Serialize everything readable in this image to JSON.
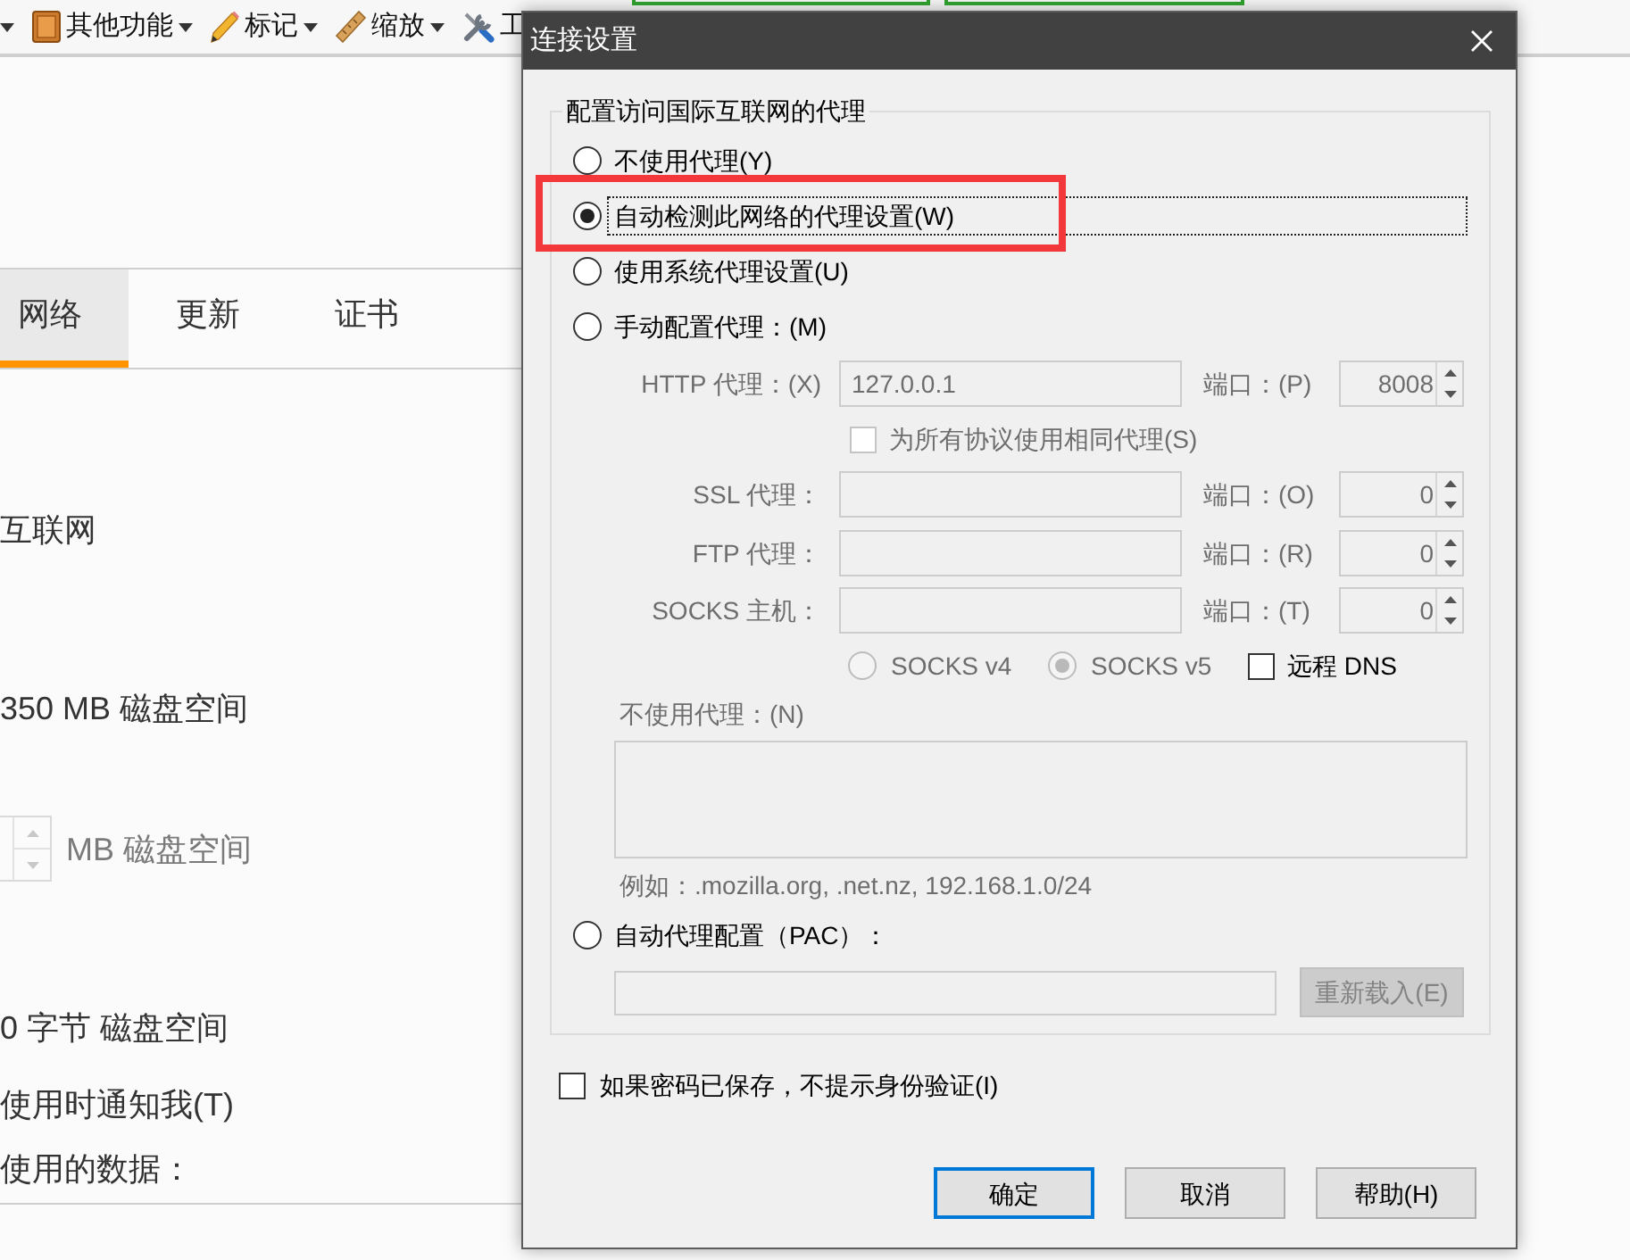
{
  "toolbar": {
    "items": [
      {
        "label": "其他功能",
        "dropdown": true
      },
      {
        "label": "标记",
        "dropdown": true
      },
      {
        "label": "缩放",
        "dropdown": true
      },
      {
        "label": "工",
        "dropdown": false
      }
    ]
  },
  "settings_panel": {
    "tabs": [
      {
        "label": "网络",
        "selected": true
      },
      {
        "label": "更新",
        "selected": false
      },
      {
        "label": "证书",
        "selected": false
      }
    ],
    "lines": [
      {
        "kind": "text",
        "text": "互联网",
        "disabled": false
      },
      {
        "kind": "text",
        "text": "350 MB 磁盘空间",
        "disabled": false
      },
      {
        "kind": "spinner",
        "text": "MB 磁盘空间",
        "disabled": true
      },
      {
        "kind": "text",
        "text": "0 字节 磁盘空间",
        "disabled": false
      },
      {
        "kind": "text",
        "text": "使用时通知我(T)",
        "disabled": false
      },
      {
        "kind": "text",
        "text": "使用的数据：",
        "disabled": false
      }
    ]
  },
  "dialog": {
    "title": "连接设置",
    "proxy_group": {
      "legend": "配置访问国际互联网的代理",
      "modes": [
        {
          "label": "不使用代理(Y)",
          "selected": false,
          "focused": false,
          "highlighted": false
        },
        {
          "label": "自动检测此网络的代理设置(W)",
          "selected": true,
          "focused": true,
          "highlighted": true
        },
        {
          "label": "使用系统代理设置(U)",
          "selected": false,
          "focused": false,
          "highlighted": false
        },
        {
          "label": "手动配置代理：(M)",
          "selected": false,
          "focused": false,
          "highlighted": false
        }
      ],
      "http_proxy": {
        "label": "HTTP 代理：(X)",
        "value": "127.0.0.1",
        "port_label": "端口：(P)",
        "port": "8008",
        "disabled": true
      },
      "same_proxy": {
        "label": "为所有协议使用相同代理(S)",
        "checked": false,
        "disabled": true
      },
      "other_proxies": [
        {
          "label": "SSL 代理：",
          "port_label": "端口：(O)",
          "port": "0",
          "disabled": true
        },
        {
          "label": "FTP 代理：",
          "port_label": "端口：(R)",
          "port": "0",
          "disabled": true
        },
        {
          "label": "SOCKS 主机：",
          "port_label": "端口：(T)",
          "port": "0",
          "disabled": true
        }
      ],
      "socks_versions": [
        {
          "label": "SOCKS v4",
          "selected": false,
          "disabled": true
        },
        {
          "label": "SOCKS v5",
          "selected": true,
          "disabled": true
        }
      ],
      "remote_dns": {
        "label": "远程 DNS",
        "checked": false,
        "disabled": false
      },
      "no_proxy": {
        "label": "不使用代理：(N)",
        "example": "例如：.mozilla.org, .net.nz, 192.168.1.0/24",
        "disabled": true
      },
      "pac": {
        "label": "自动代理配置（PAC）：",
        "selected": false,
        "focused": false,
        "highlighted": false,
        "reload_label": "重新载入(E)",
        "disabled": true
      }
    },
    "auth": {
      "label": "如果密码已保存，不提示身份验证(I)",
      "checked": false
    },
    "buttons": [
      {
        "label": "确定",
        "default": true
      },
      {
        "label": "取消",
        "default": false
      },
      {
        "label": "帮助(H)",
        "default": false
      }
    ]
  }
}
